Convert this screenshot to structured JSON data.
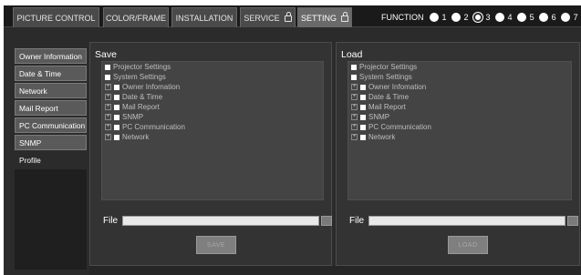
{
  "tabs": [
    {
      "label": "PICTURE CONTROL",
      "lock": false
    },
    {
      "label": "COLOR/FRAME",
      "lock": false
    },
    {
      "label": "INSTALLATION",
      "lock": false
    },
    {
      "label": "SERVICE",
      "lock": true
    },
    {
      "label": "SETTING",
      "lock": true,
      "active": true
    }
  ],
  "function": {
    "label": "FUNCTION",
    "options": [
      "1",
      "2",
      "3",
      "4",
      "5",
      "6",
      "7"
    ],
    "selected": "3"
  },
  "sidebar": {
    "items": [
      {
        "label": "Owner Information"
      },
      {
        "label": "Date & Time"
      },
      {
        "label": "Network"
      },
      {
        "label": "Mail Report"
      },
      {
        "label": "PC Communication"
      },
      {
        "label": "SNMP"
      },
      {
        "label": "Profile",
        "active": true
      }
    ]
  },
  "save": {
    "title": "Save",
    "tree": {
      "projector_settings": "Projector Settings",
      "system_settings": "System Settings",
      "children": [
        "Owner Infomation",
        "Date & Time",
        "Mail Report",
        "SNMP",
        "PC Communication",
        "Network"
      ]
    },
    "file_label": "File",
    "file_value": "",
    "button_label": "SAVE"
  },
  "load": {
    "title": "Load",
    "tree": {
      "projector_settings": "Projector Settings",
      "system_settings": "System Settings",
      "children": [
        "Owner Infomation",
        "Date & Time",
        "Mail Report",
        "SNMP",
        "PC Communication",
        "Network"
      ]
    },
    "file_label": "File",
    "file_value": "",
    "button_label": "LOAD"
  }
}
